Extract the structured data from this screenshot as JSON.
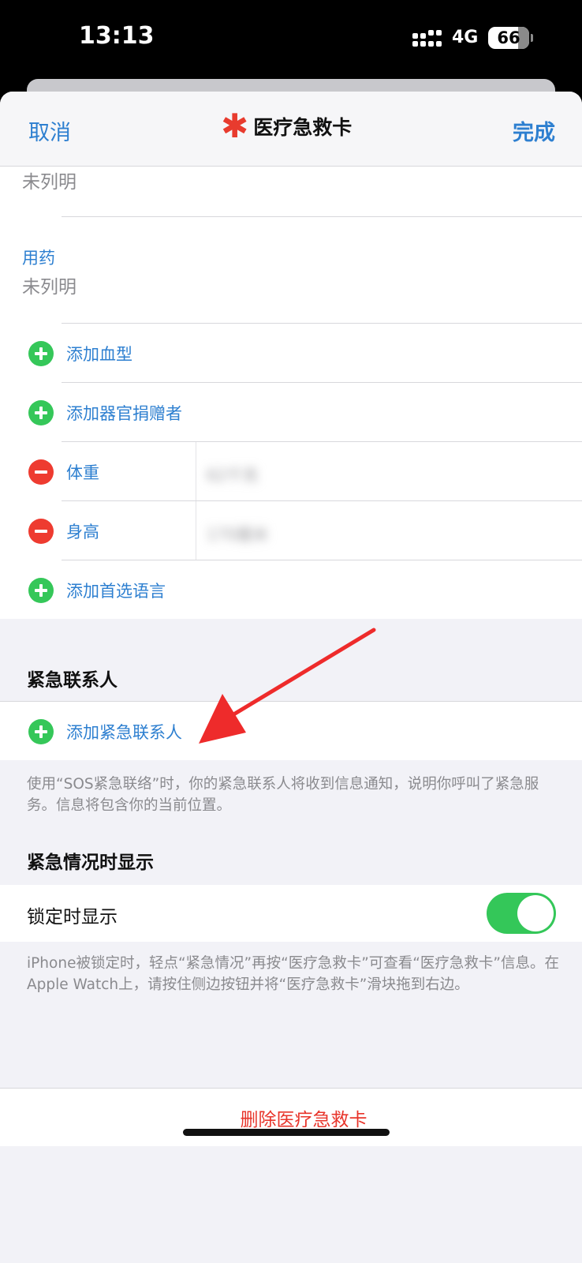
{
  "status_bar": {
    "time": "13:13",
    "network": "4G",
    "battery": "66"
  },
  "nav": {
    "cancel": "取消",
    "title": "医疗急救卡",
    "done": "完成"
  },
  "medical": {
    "allergy_value": "未列明",
    "medication_label": "用药",
    "medication_value": "未列明"
  },
  "rows": [
    {
      "type": "add",
      "label": "添加血型"
    },
    {
      "type": "add",
      "label": "添加器官捐赠者"
    },
    {
      "type": "remove",
      "label": "体重",
      "value": "62千克"
    },
    {
      "type": "remove",
      "label": "身高",
      "value": "170厘米"
    },
    {
      "type": "add",
      "label": "添加首选语言"
    }
  ],
  "emergency_contacts": {
    "header": "紧急联系人",
    "add_label": "添加紧急联系人",
    "footnote": "使用“SOS紧急联络”时，你的紧急联系人将收到信息通知，说明你呼叫了紧急服务。信息将包含你的当前位置。"
  },
  "emergency_access": {
    "header": "紧急情况时显示",
    "toggle_label": "锁定时显示",
    "toggle_on": true,
    "footnote": "iPhone被锁定时，轻点“紧急情况”再按“医疗急救卡”可查看“医疗急救卡”信息。在Apple Watch上，请按住侧边按钮并将“医疗急救卡”滑块拖到右边。"
  },
  "delete_label": "删除医疗急救卡",
  "colors": {
    "accent": "#2d7fd0",
    "add": "#35c759",
    "remove": "#ee3b30",
    "toggle_on": "#34c759",
    "destructive": "#e8352b",
    "annotation": "#ee2b2b"
  }
}
